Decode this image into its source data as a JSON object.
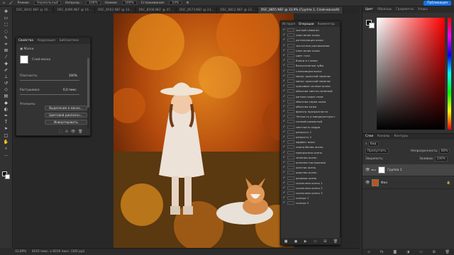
{
  "options_bar": {
    "mode_label": "Режим:",
    "mode_value": "Нормальный",
    "opacity_label": "Непрозр.:",
    "opacity_value": "100%",
    "pressure_label": "Нажим:",
    "pressure_value": "100%",
    "smoothing_label": "Сглаживание:",
    "smoothing_value": "10%",
    "publish_label": "Публикация"
  },
  "doc_tabs": [
    {
      "label": "DSC_8441.NEF @ 16..."
    },
    {
      "label": "DSC_8486.NEF @ 16..."
    },
    {
      "label": "DSC_8502.NEF @ 33..."
    },
    {
      "label": "DSC_8508.NEF @ 47..."
    },
    {
      "label": "DSC_8573.NEF @ 23..."
    },
    {
      "label": "DSC_8812.NEF @ 23..."
    },
    {
      "label": "DSC_8855.NEF @ 33,9% (Группа 1, Слой-маска/8)"
    }
  ],
  "tools": [
    "move",
    "artboard",
    "marquee",
    "lasso",
    "quick-select",
    "crop",
    "frame",
    "eyedropper",
    "healing",
    "brush",
    "clone",
    "history-brush",
    "eraser",
    "gradient",
    "blur",
    "dodge",
    "pen",
    "type",
    "path-select",
    "rectangle",
    "hand",
    "zoom",
    "more"
  ],
  "properties": {
    "tabs": [
      "Свойства",
      "Коррекция",
      "Библиотеки"
    ],
    "title": "Маски",
    "layer_mask_label": "Слой-маска",
    "density_label": "Плотность:",
    "density_value": "100%",
    "feather_label": "Растушевка:",
    "feather_value": "0,0 пикс.",
    "refine_label": "Уточнить:",
    "select_mask_button": "Выделение и маска...",
    "color_range_button": "Цветовой диапазон...",
    "invert_button": "Инвертировать"
  },
  "history": {
    "tabs": [
      "История",
      "Операции",
      "Комментар"
    ],
    "items": [
      "чистый самогон",
      "смягчение кожи",
      "детализация кожи",
      "частотное разложение",
      "смягчение кожи",
      "цвет глаз",
      "блики в глазах",
      "белоснежные зубы",
      "стилизация волос",
      "минус красный перенас",
      "минус красный перенас",
      "красивые сочные осень",
      "обычное светло-зеленый",
      "детали через тени",
      "обычная серая кожа",
      "обычная кожа",
      "фильтр прозрачности",
      "Четкость и микроконтраст",
      "сочный размытый",
      "светлость кадра",
      "резкость 1",
      "резкость 2",
      "эффект вина",
      "черно-белая осень",
      "прекрасная осень",
      "зеленая осень",
      "осеннее настроение",
      "желтая осень",
      "красная осень",
      "розовая осень",
      "сказочная осень 1",
      "сказочная осень 2",
      "сказочная осень 3",
      "солнце 1",
      "солнце 2"
    ]
  },
  "color_panel": {
    "tabs": [
      "Цвет",
      "Образцы",
      "Градиенты",
      "Узоры"
    ],
    "foreground": "#000000",
    "background": "#ffffff"
  },
  "layers_panel": {
    "tabs": [
      "Слои",
      "Каналы",
      "Контуры"
    ],
    "filter_label": "Вид",
    "blend_mode": "Пропустить",
    "opacity_label": "Непрозрачность:",
    "opacity_value": "80%",
    "lock_label": "Закрепить:",
    "fill_label": "Заливка:",
    "fill_value": "100%",
    "layers": [
      {
        "name": "Группа 1",
        "selected": true
      },
      {
        "name": "Фон",
        "selected": false
      }
    ]
  },
  "status": {
    "zoom": "33,89%",
    "doc_info": "4016 пикс. x 6016 пикс. (300 ppi)"
  }
}
